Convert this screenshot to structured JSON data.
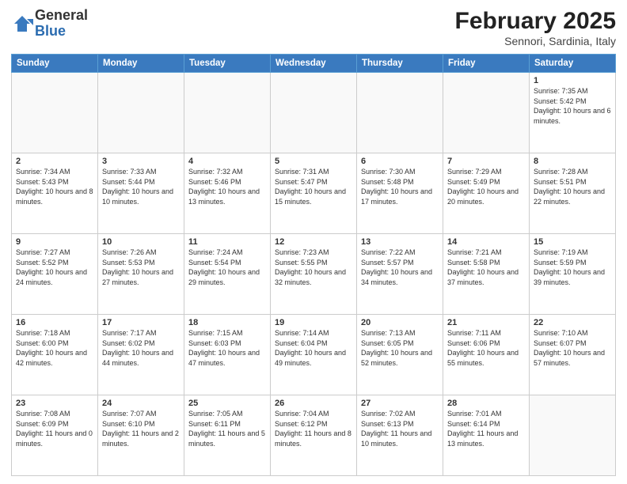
{
  "header": {
    "logo_general": "General",
    "logo_blue": "Blue",
    "month": "February 2025",
    "location": "Sennori, Sardinia, Italy"
  },
  "weekdays": [
    "Sunday",
    "Monday",
    "Tuesday",
    "Wednesday",
    "Thursday",
    "Friday",
    "Saturday"
  ],
  "weeks": [
    [
      {
        "day": "",
        "sunrise": "",
        "sunset": "",
        "daylight": ""
      },
      {
        "day": "",
        "sunrise": "",
        "sunset": "",
        "daylight": ""
      },
      {
        "day": "",
        "sunrise": "",
        "sunset": "",
        "daylight": ""
      },
      {
        "day": "",
        "sunrise": "",
        "sunset": "",
        "daylight": ""
      },
      {
        "day": "",
        "sunrise": "",
        "sunset": "",
        "daylight": ""
      },
      {
        "day": "",
        "sunrise": "",
        "sunset": "",
        "daylight": ""
      },
      {
        "day": "1",
        "sunrise": "Sunrise: 7:35 AM",
        "sunset": "Sunset: 5:42 PM",
        "daylight": "Daylight: 10 hours and 6 minutes."
      }
    ],
    [
      {
        "day": "2",
        "sunrise": "Sunrise: 7:34 AM",
        "sunset": "Sunset: 5:43 PM",
        "daylight": "Daylight: 10 hours and 8 minutes."
      },
      {
        "day": "3",
        "sunrise": "Sunrise: 7:33 AM",
        "sunset": "Sunset: 5:44 PM",
        "daylight": "Daylight: 10 hours and 10 minutes."
      },
      {
        "day": "4",
        "sunrise": "Sunrise: 7:32 AM",
        "sunset": "Sunset: 5:46 PM",
        "daylight": "Daylight: 10 hours and 13 minutes."
      },
      {
        "day": "5",
        "sunrise": "Sunrise: 7:31 AM",
        "sunset": "Sunset: 5:47 PM",
        "daylight": "Daylight: 10 hours and 15 minutes."
      },
      {
        "day": "6",
        "sunrise": "Sunrise: 7:30 AM",
        "sunset": "Sunset: 5:48 PM",
        "daylight": "Daylight: 10 hours and 17 minutes."
      },
      {
        "day": "7",
        "sunrise": "Sunrise: 7:29 AM",
        "sunset": "Sunset: 5:49 PM",
        "daylight": "Daylight: 10 hours and 20 minutes."
      },
      {
        "day": "8",
        "sunrise": "Sunrise: 7:28 AM",
        "sunset": "Sunset: 5:51 PM",
        "daylight": "Daylight: 10 hours and 22 minutes."
      }
    ],
    [
      {
        "day": "9",
        "sunrise": "Sunrise: 7:27 AM",
        "sunset": "Sunset: 5:52 PM",
        "daylight": "Daylight: 10 hours and 24 minutes."
      },
      {
        "day": "10",
        "sunrise": "Sunrise: 7:26 AM",
        "sunset": "Sunset: 5:53 PM",
        "daylight": "Daylight: 10 hours and 27 minutes."
      },
      {
        "day": "11",
        "sunrise": "Sunrise: 7:24 AM",
        "sunset": "Sunset: 5:54 PM",
        "daylight": "Daylight: 10 hours and 29 minutes."
      },
      {
        "day": "12",
        "sunrise": "Sunrise: 7:23 AM",
        "sunset": "Sunset: 5:55 PM",
        "daylight": "Daylight: 10 hours and 32 minutes."
      },
      {
        "day": "13",
        "sunrise": "Sunrise: 7:22 AM",
        "sunset": "Sunset: 5:57 PM",
        "daylight": "Daylight: 10 hours and 34 minutes."
      },
      {
        "day": "14",
        "sunrise": "Sunrise: 7:21 AM",
        "sunset": "Sunset: 5:58 PM",
        "daylight": "Daylight: 10 hours and 37 minutes."
      },
      {
        "day": "15",
        "sunrise": "Sunrise: 7:19 AM",
        "sunset": "Sunset: 5:59 PM",
        "daylight": "Daylight: 10 hours and 39 minutes."
      }
    ],
    [
      {
        "day": "16",
        "sunrise": "Sunrise: 7:18 AM",
        "sunset": "Sunset: 6:00 PM",
        "daylight": "Daylight: 10 hours and 42 minutes."
      },
      {
        "day": "17",
        "sunrise": "Sunrise: 7:17 AM",
        "sunset": "Sunset: 6:02 PM",
        "daylight": "Daylight: 10 hours and 44 minutes."
      },
      {
        "day": "18",
        "sunrise": "Sunrise: 7:15 AM",
        "sunset": "Sunset: 6:03 PM",
        "daylight": "Daylight: 10 hours and 47 minutes."
      },
      {
        "day": "19",
        "sunrise": "Sunrise: 7:14 AM",
        "sunset": "Sunset: 6:04 PM",
        "daylight": "Daylight: 10 hours and 49 minutes."
      },
      {
        "day": "20",
        "sunrise": "Sunrise: 7:13 AM",
        "sunset": "Sunset: 6:05 PM",
        "daylight": "Daylight: 10 hours and 52 minutes."
      },
      {
        "day": "21",
        "sunrise": "Sunrise: 7:11 AM",
        "sunset": "Sunset: 6:06 PM",
        "daylight": "Daylight: 10 hours and 55 minutes."
      },
      {
        "day": "22",
        "sunrise": "Sunrise: 7:10 AM",
        "sunset": "Sunset: 6:07 PM",
        "daylight": "Daylight: 10 hours and 57 minutes."
      }
    ],
    [
      {
        "day": "23",
        "sunrise": "Sunrise: 7:08 AM",
        "sunset": "Sunset: 6:09 PM",
        "daylight": "Daylight: 11 hours and 0 minutes."
      },
      {
        "day": "24",
        "sunrise": "Sunrise: 7:07 AM",
        "sunset": "Sunset: 6:10 PM",
        "daylight": "Daylight: 11 hours and 2 minutes."
      },
      {
        "day": "25",
        "sunrise": "Sunrise: 7:05 AM",
        "sunset": "Sunset: 6:11 PM",
        "daylight": "Daylight: 11 hours and 5 minutes."
      },
      {
        "day": "26",
        "sunrise": "Sunrise: 7:04 AM",
        "sunset": "Sunset: 6:12 PM",
        "daylight": "Daylight: 11 hours and 8 minutes."
      },
      {
        "day": "27",
        "sunrise": "Sunrise: 7:02 AM",
        "sunset": "Sunset: 6:13 PM",
        "daylight": "Daylight: 11 hours and 10 minutes."
      },
      {
        "day": "28",
        "sunrise": "Sunrise: 7:01 AM",
        "sunset": "Sunset: 6:14 PM",
        "daylight": "Daylight: 11 hours and 13 minutes."
      },
      {
        "day": "",
        "sunrise": "",
        "sunset": "",
        "daylight": ""
      }
    ]
  ]
}
